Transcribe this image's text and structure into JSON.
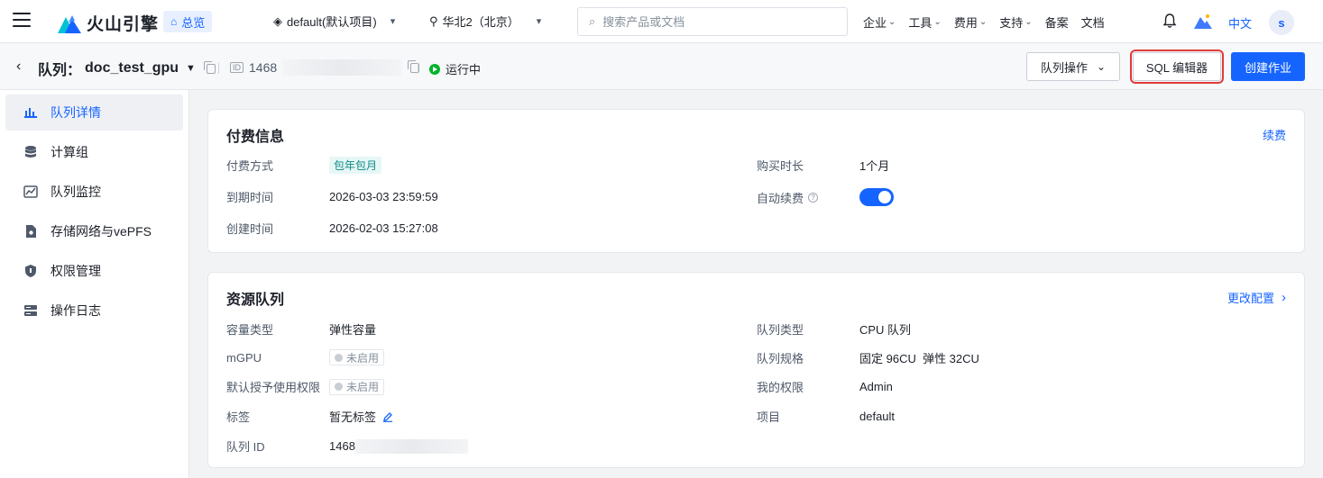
{
  "topnav": {
    "logo_text": "火山引擎",
    "home_label": "总览",
    "project_select": "default(默认项目)",
    "region_select": "华北2（北京）",
    "search_placeholder": "搜索产品或文档",
    "links": [
      {
        "label": "企业",
        "dropdown": true
      },
      {
        "label": "工具",
        "dropdown": true
      },
      {
        "label": "费用",
        "dropdown": true
      },
      {
        "label": "支持",
        "dropdown": true
      },
      {
        "label": "备案",
        "dropdown": false
      },
      {
        "label": "文档",
        "dropdown": false
      }
    ],
    "lang": "中文",
    "avatar": "s"
  },
  "subhead": {
    "title_prefix": "队列：",
    "queue_name": "doc_test_gpu",
    "id_badge": "ID",
    "id_prefix": "1468",
    "status": "运行中",
    "btn_ops": "队列操作",
    "btn_sql": "SQL 编辑器",
    "btn_create": "创建作业"
  },
  "sidebar": {
    "items": [
      {
        "label": "队列详情",
        "icon": "bar-chart-icon",
        "active": true
      },
      {
        "label": "计算组",
        "icon": "database-icon",
        "active": false
      },
      {
        "label": "队列监控",
        "icon": "monitor-chart-icon",
        "active": false
      },
      {
        "label": "存储网络与vePFS",
        "icon": "storage-gear-icon",
        "active": false
      },
      {
        "label": "权限管理",
        "icon": "shield-icon",
        "active": false
      },
      {
        "label": "操作日志",
        "icon": "log-icon",
        "active": false
      }
    ]
  },
  "billing": {
    "title": "付费信息",
    "link": "续费",
    "pay_method_label": "付费方式",
    "pay_method_value": "包年包月",
    "expire_label": "到期时间",
    "expire_value": "2026-03-03 23:59:59",
    "created_label": "创建时间",
    "created_value": "2026-02-03 15:27:08",
    "duration_label": "购买时长",
    "duration_value": "1个月",
    "auto_renew_label": "自动续费",
    "auto_renew_on": true
  },
  "resource": {
    "title": "资源队列",
    "link": "更改配置",
    "capacity_label": "容量类型",
    "capacity_value": "弹性容量",
    "mgpu_label": "mGPU",
    "mgpu_value": "未启用",
    "default_perm_label": "默认授予使用权限",
    "default_perm_value": "未启用",
    "tag_label": "标签",
    "tag_value": "暂无标签",
    "qid_label": "队列 ID",
    "qid_prefix": "1468",
    "type_label": "队列类型",
    "type_value": "CPU 队列",
    "spec_label": "队列规格",
    "spec_value": "固定 96CU  弹性 32CU",
    "my_perm_label": "我的权限",
    "my_perm_value": "Admin",
    "project_label": "项目",
    "project_value": "default"
  }
}
